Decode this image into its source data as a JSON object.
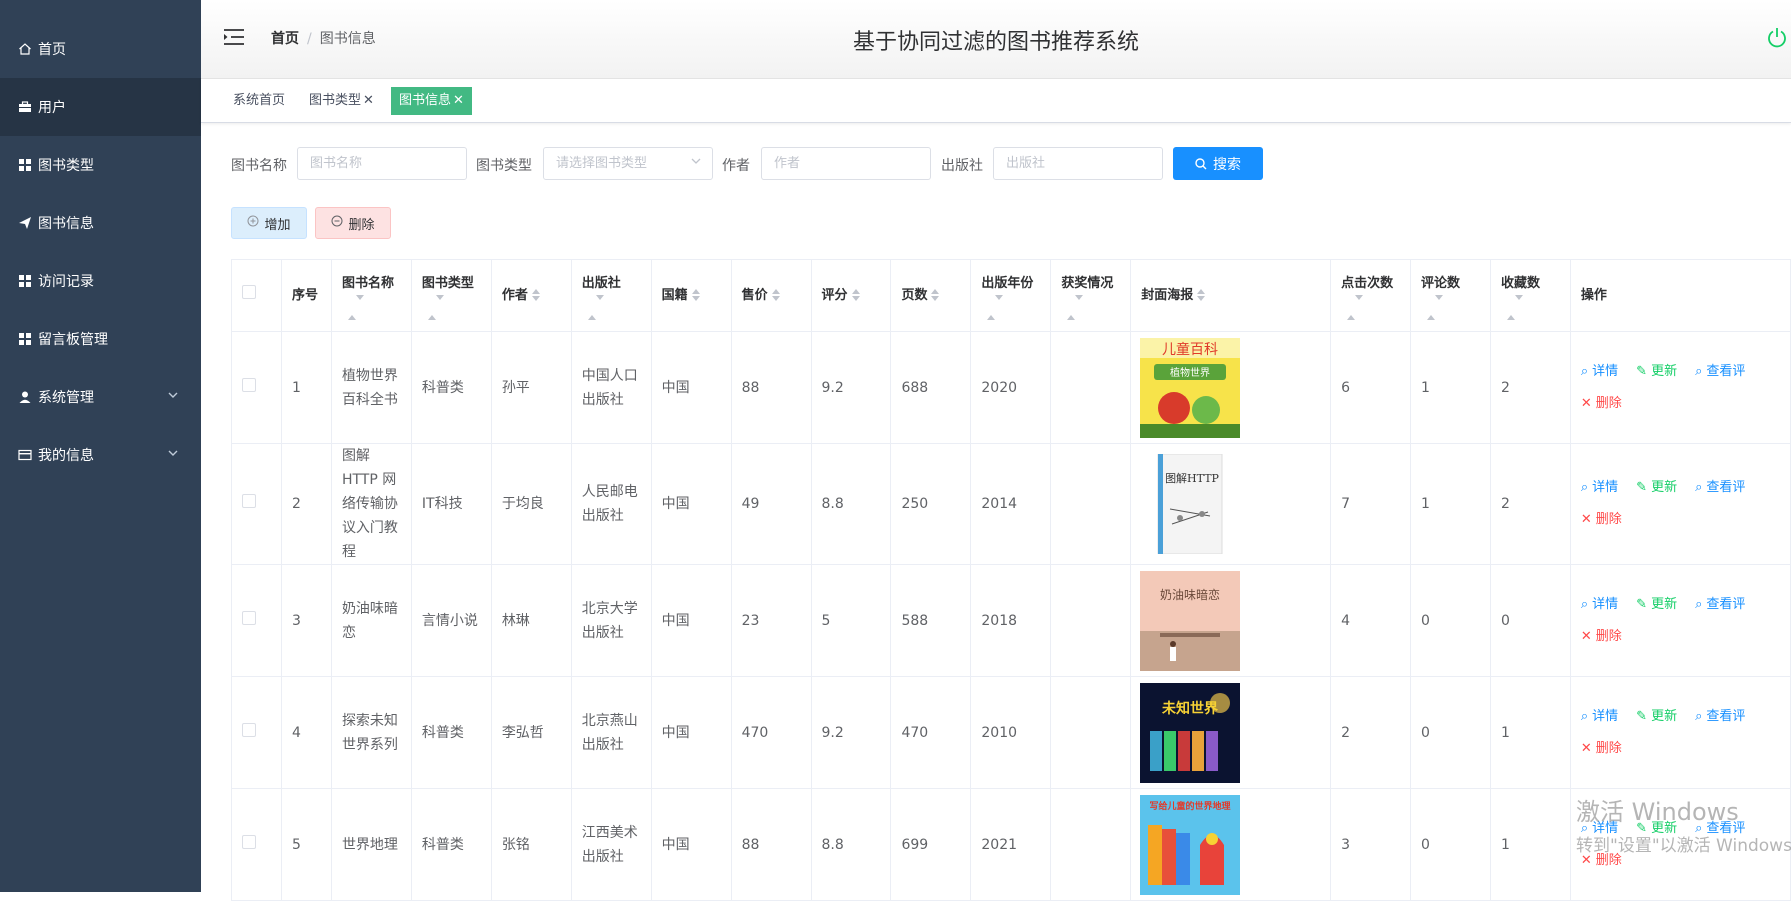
{
  "sidebar": {
    "items": [
      {
        "label": "首页",
        "icon": "home-icon"
      },
      {
        "label": "用户",
        "icon": "briefcase-icon"
      },
      {
        "label": "图书类型",
        "icon": "grid-icon"
      },
      {
        "label": "图书信息",
        "icon": "send-icon"
      },
      {
        "label": "访问记录",
        "icon": "grid-icon"
      },
      {
        "label": "留言板管理",
        "icon": "grid-icon"
      },
      {
        "label": "系统管理",
        "icon": "user-icon"
      },
      {
        "label": "我的信息",
        "icon": "card-icon"
      }
    ],
    "bg_color": "#304156"
  },
  "header": {
    "breadcrumb": [
      "首页",
      "图书信息"
    ],
    "title": "基于协同过滤的图书推荐系统"
  },
  "tabs": [
    {
      "label": "系统首页"
    },
    {
      "label": "图书类型",
      "close": "✕"
    },
    {
      "label": "图书信息",
      "close": "✕"
    }
  ],
  "filters": {
    "name_label": "图书名称",
    "name_placeholder": "图书名称",
    "type_label": "图书类型",
    "type_placeholder": "请选择图书类型",
    "author_label": "作者",
    "author_placeholder": "作者",
    "publisher_label": "出版社",
    "publisher_placeholder": "出版社",
    "search_label": "搜索"
  },
  "actions": {
    "add_label": "增加",
    "delete_label": "删除"
  },
  "table": {
    "headers": [
      "序号",
      "图书名称",
      "图书类型",
      "作者",
      "出版社",
      "国籍",
      "售价",
      "评分",
      "页数",
      "出版年份",
      "获奖情况",
      "封面海报",
      "点击次数",
      "评论数",
      "收藏数",
      "操作"
    ],
    "rows": [
      {
        "no": "1",
        "name": "植物世界百科全书",
        "type": "科普类",
        "author": "孙平",
        "publisher": "中国人口出版社",
        "country": "中国",
        "price": "88",
        "score": "9.2",
        "pages": "688",
        "year": "2020",
        "award": "",
        "cover_text": "儿童百科",
        "cover_sub": "植物世界",
        "clicks": "6",
        "comments": "1",
        "favs": "2"
      },
      {
        "no": "2",
        "name": "图解HTTP 网络传输协议入门教程",
        "type": "IT科技",
        "author": "于均良",
        "publisher": "人民邮电出版社",
        "country": "中国",
        "price": "49",
        "score": "8.8",
        "pages": "250",
        "year": "2014",
        "award": "",
        "cover_text": "图解HTTP",
        "cover_sub": "",
        "clicks": "7",
        "comments": "1",
        "favs": "2"
      },
      {
        "no": "3",
        "name": "奶油味暗恋",
        "type": "言情小说",
        "author": "林琳",
        "publisher": "北京大学出版社",
        "country": "中国",
        "price": "23",
        "score": "5",
        "pages": "588",
        "year": "2018",
        "award": "",
        "cover_text": "奶油味暗恋",
        "cover_sub": "",
        "clicks": "4",
        "comments": "0",
        "favs": "0"
      },
      {
        "no": "4",
        "name": "探索未知世界系列",
        "type": "科普类",
        "author": "李弘哲",
        "publisher": "北京燕山出版社",
        "country": "中国",
        "price": "470",
        "score": "9.2",
        "pages": "470",
        "year": "2010",
        "award": "",
        "cover_text": "未知世界",
        "cover_sub": "",
        "clicks": "2",
        "comments": "0",
        "favs": "1"
      },
      {
        "no": "5",
        "name": "世界地理",
        "type": "科普类",
        "author": "张铭",
        "publisher": "江西美术出版社",
        "country": "中国",
        "price": "88",
        "score": "8.8",
        "pages": "699",
        "year": "2021",
        "award": "",
        "cover_text": "写给儿童的世界地理",
        "cover_sub": "",
        "clicks": "3",
        "comments": "0",
        "favs": "1"
      }
    ],
    "ops": {
      "detail": "详情",
      "update": "更新",
      "review": "查看评",
      "delete": "删除"
    }
  },
  "watermark": {
    "line1": "激活 Windows",
    "line2": "转到\"设置\"以激活 Windows"
  },
  "colors": {
    "accent": "#1890ff",
    "tab_active": "#42b983",
    "power": "#13ce66"
  }
}
